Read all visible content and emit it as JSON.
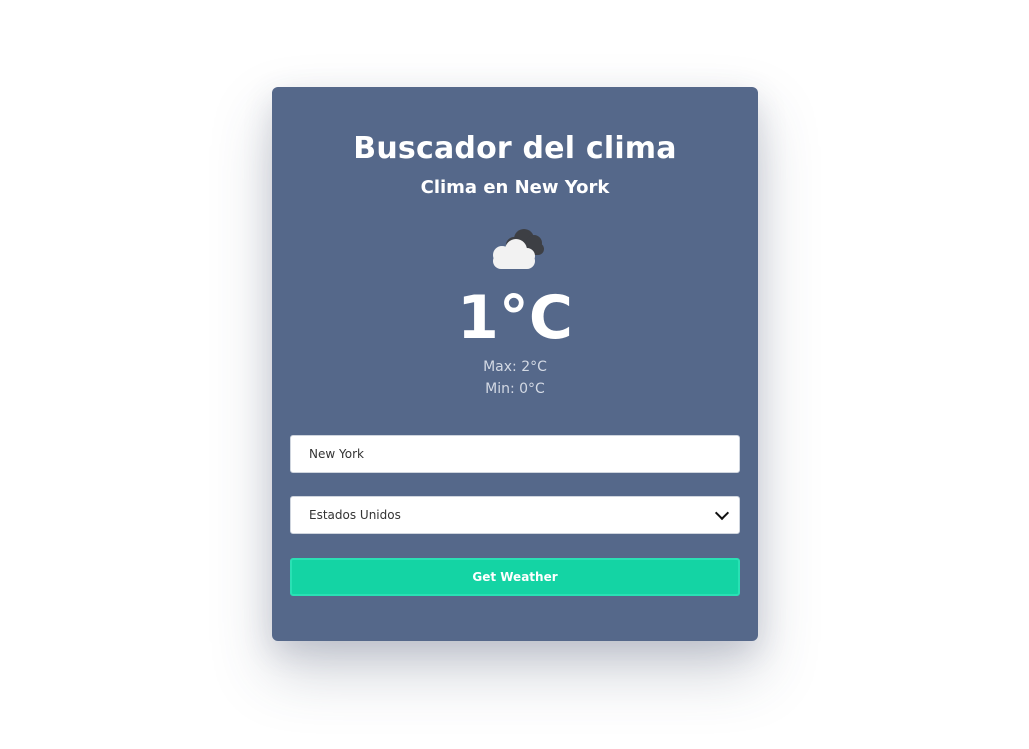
{
  "header": {
    "title": "Buscador del clima",
    "subtitle": "Clima en New York"
  },
  "weather": {
    "icon": "cloud-icon",
    "temperature": "1°C",
    "max": "Max: 2°C",
    "min": "Min: 0°C"
  },
  "form": {
    "city_value": "New York",
    "country_selected": "Estados Unidos",
    "submit_label": "Get Weather"
  },
  "colors": {
    "card_bg": "#55688a",
    "button_bg": "#14d4a4",
    "page_bg": "#ffffff"
  }
}
